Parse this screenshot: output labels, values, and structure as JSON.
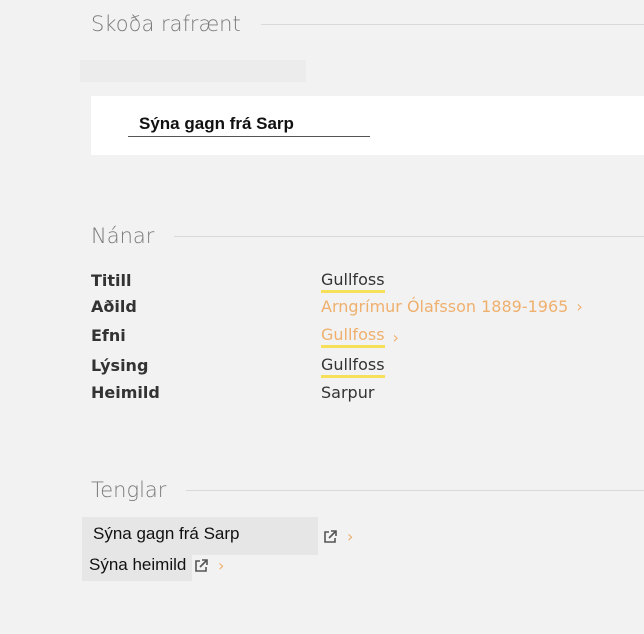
{
  "view_section": {
    "heading": "Skoða rafrænt",
    "button_label": "Sýna gagn frá Sarp"
  },
  "detail_section": {
    "heading": "Nánar",
    "rows": [
      {
        "label": "Titill",
        "value": "Gullfoss",
        "style": "highlight"
      },
      {
        "label": "Aðild",
        "value": "Arngrímur Ólafsson 1889-1965",
        "style": "link"
      },
      {
        "label": "Efni",
        "value": "Gullfoss",
        "style": "highlight-link"
      },
      {
        "label": "Lýsing",
        "value": "Gullfoss",
        "style": "highlight"
      },
      {
        "label": "Heimild",
        "value": "Sarpur",
        "style": "plain"
      }
    ]
  },
  "links_section": {
    "heading": "Tenglar",
    "links": [
      {
        "label": "Sýna gagn frá Sarp",
        "icon": "external-link-icon"
      },
      {
        "label": "Sýna heimild",
        "icon": "external-link-icon"
      }
    ]
  },
  "colors": {
    "background": "#f2f2f2",
    "panel": "#ffffff",
    "link_orange": "#efb06e",
    "highlight_yellow": "#f6e05a",
    "heading_gray": "#7a7a7a"
  }
}
